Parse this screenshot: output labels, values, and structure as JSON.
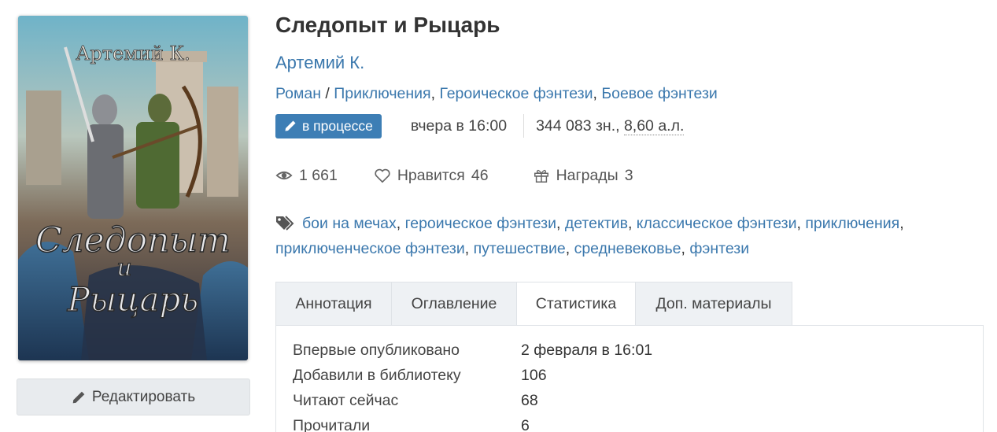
{
  "book": {
    "title": "Следопыт и Рыцарь",
    "author": "Артемий К.",
    "genre_prefix": "Роман",
    "genre_separator": " / ",
    "genres": [
      "Приключения",
      "Героическое фэнтези",
      "Боевое фэнтези"
    ],
    "status": "в процессе",
    "updated": "вчера в 16:00",
    "size_chars": "344 083 зн., ",
    "size_sheets": "8,60 а.л.",
    "cover": {
      "author_text": "Артемий К.",
      "title_line1": "Следопыт",
      "title_line2": "и",
      "title_line3": "Рыцарь"
    }
  },
  "stats": {
    "views": "1 661",
    "likes_label": "Нравится",
    "likes_count": "46",
    "awards_label": "Награды",
    "awards_count": "3"
  },
  "tags": [
    "бои на мечах",
    "героическое фэнтези",
    "детектив",
    "классическое фэнтези",
    "приключения",
    "приключенческое фэнтези",
    "путешествие",
    "средневековье",
    "фэнтези"
  ],
  "actions": {
    "edit_label": "Редактировать"
  },
  "tabs": [
    {
      "label": "Аннотация",
      "active": false
    },
    {
      "label": "Оглавление",
      "active": false
    },
    {
      "label": "Статистика",
      "active": true
    },
    {
      "label": "Доп. материалы",
      "active": false
    }
  ],
  "statistics": [
    {
      "key": "Впервые опубликовано",
      "value": "2 февраля в 16:01"
    },
    {
      "key": "Добавили в библиотеку",
      "value": "106"
    },
    {
      "key": "Читают сейчас",
      "value": "68"
    },
    {
      "key": "Прочитали",
      "value": "6"
    }
  ],
  "colors": {
    "link": "#3b78ad",
    "badge": "#3d7eb5",
    "button_bg": "#e8ebee",
    "tab_bg": "#eef1f4"
  },
  "icons": {
    "status": "pencil-icon",
    "edit": "pencil-icon",
    "views": "eye-icon",
    "likes": "heart-icon",
    "awards": "gift-icon",
    "tags": "tags-icon"
  }
}
